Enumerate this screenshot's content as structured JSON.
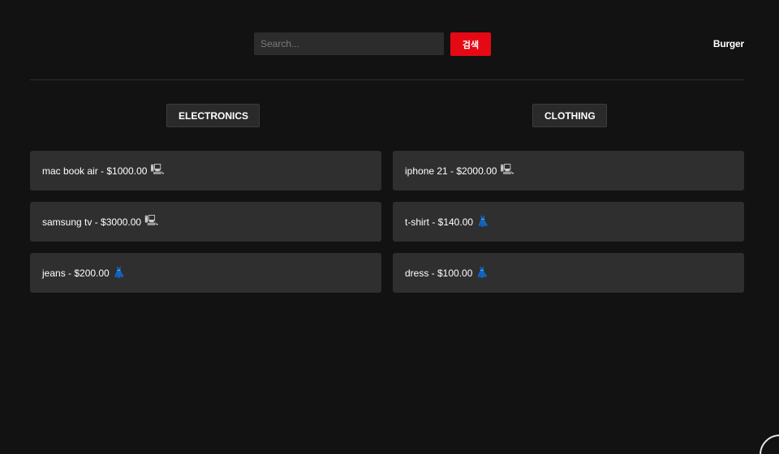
{
  "header": {
    "search": {
      "placeholder": "Search...",
      "value": ""
    },
    "search_button_label": "검색",
    "menu_label": "Burger"
  },
  "categories": [
    {
      "label": "ELECTRONICS"
    },
    {
      "label": "CLOTHING"
    }
  ],
  "products": [
    {
      "label": "mac book air - $1000.00",
      "icon_name": "computer-icon",
      "icon_glyph": "🖳"
    },
    {
      "label": "iphone 21 - $2000.00",
      "icon_name": "computer-icon",
      "icon_glyph": "🖳"
    },
    {
      "label": "samsung tv - $3000.00",
      "icon_name": "computer-icon",
      "icon_glyph": "🖳"
    },
    {
      "label": "t-shirt - $140.00",
      "icon_name": "dress-icon",
      "icon_glyph": "👗"
    },
    {
      "label": "jeans - $200.00",
      "icon_name": "dress-icon",
      "icon_glyph": "👗"
    },
    {
      "label": "dress - $100.00",
      "icon_name": "dress-icon",
      "icon_glyph": "👗"
    }
  ],
  "colors": {
    "background": "#121212",
    "card": "#2f2f2f",
    "accent": "#e50914",
    "dress_icon": "#3ec6c2"
  }
}
